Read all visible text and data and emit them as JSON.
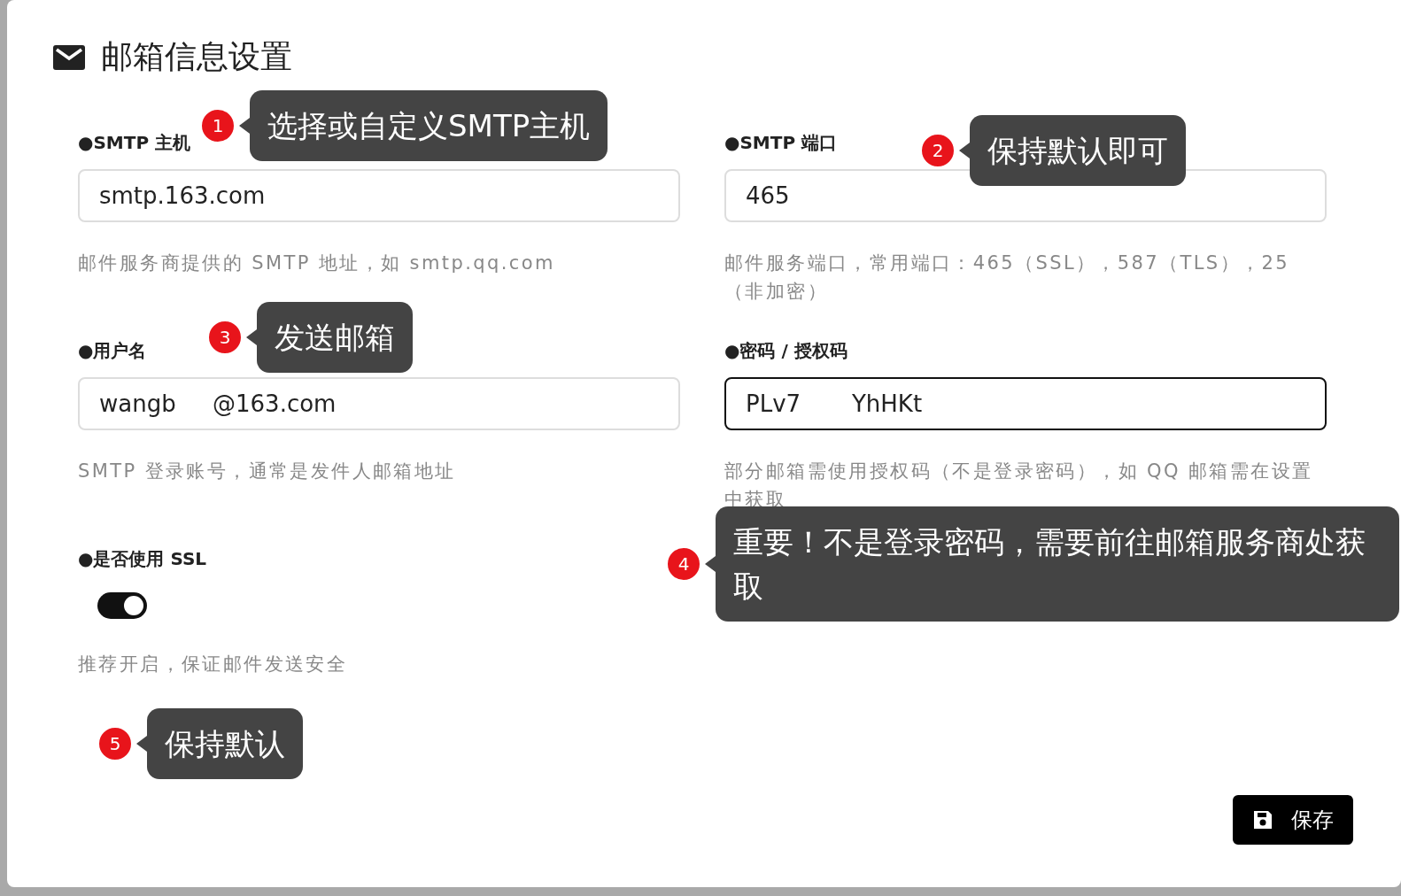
{
  "dialog": {
    "title": "邮箱信息设置"
  },
  "fields": [
    {
      "kind": "text",
      "label": "●SMTP 主机",
      "value": "smtp.163.com",
      "help": "邮件服务商提供的 SMTP 地址，如 smtp.qq.com",
      "focused": false
    },
    {
      "kind": "text",
      "label": "●SMTP 端口",
      "value": "465",
      "help": "邮件服务端口，常用端口：465（SSL），587（TLS），25（非加密）",
      "focused": false
    },
    {
      "kind": "text",
      "label": "●用户名",
      "value": "wangb     @163.com",
      "help": "SMTP 登录账号，通常是发件人邮箱地址",
      "focused": false
    },
    {
      "kind": "text",
      "label": "●密码 / 授权码",
      "value": "PLv7       YhHKt",
      "help": "部分邮箱需使用授权码（不是登录密码），如 QQ 邮箱需在设置中获取",
      "focused": true
    },
    {
      "kind": "switch",
      "label": "●是否使用 SSL",
      "on": true,
      "help": "推荐开启，保证邮件发送安全"
    }
  ],
  "save_button": {
    "label": "保存"
  },
  "callouts": [
    {
      "number": "1",
      "text": "选择或自定义SMTP主机"
    },
    {
      "number": "2",
      "text": "保持默认即可"
    },
    {
      "number": "3",
      "text": "发送邮箱"
    },
    {
      "number": "4",
      "text": "重要！不是登录密码，需要前往邮箱服务商处获取"
    },
    {
      "number": "5",
      "text": "保持默认"
    }
  ]
}
